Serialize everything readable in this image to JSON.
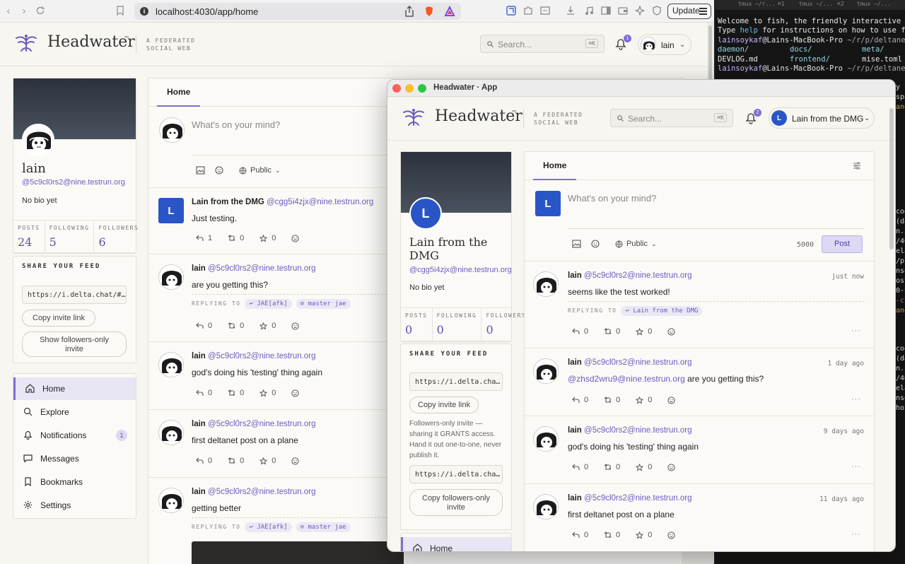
{
  "browser": {
    "url": "localhost:4030/app/home",
    "update_label": "Update"
  },
  "brand": {
    "name": "Headwater",
    "tm": "™",
    "tagline1": "A FEDERATED",
    "tagline2": "SOCIAL WEB"
  },
  "header": {
    "search_placeholder": "Search...",
    "search_kbd": "⌘K"
  },
  "main": {
    "user_name": "lain",
    "notif_count": "1",
    "profile": {
      "name": "lain",
      "handle": "@5c9cl0rs2@nine.testrun.org",
      "bio": "No bio yet",
      "stats": [
        {
          "label": "POSTS",
          "value": "24"
        },
        {
          "label": "FOLLOWING",
          "value": "5"
        },
        {
          "label": "FOLLOWERS",
          "value": "6"
        }
      ],
      "share_title": "SHARE YOUR FEED",
      "feed_link": "https://i.delta.chat/#…",
      "copy_invite": "Copy invite link",
      "followers_invite": "Show followers-only invite"
    },
    "nav": [
      {
        "label": "Home",
        "icon": "home-icon",
        "active": true
      },
      {
        "label": "Explore",
        "icon": "search-icon"
      },
      {
        "label": "Notifications",
        "icon": "bell-icon",
        "count": "1"
      },
      {
        "label": "Messages",
        "icon": "message-icon"
      },
      {
        "label": "Bookmarks",
        "icon": "bookmark-icon"
      },
      {
        "label": "Settings",
        "icon": "gear-icon"
      }
    ],
    "tab": "Home",
    "compose_placeholder": "What's on your mind?",
    "visibility": "Public",
    "posts": [
      {
        "author": "Lain from the DMG",
        "handle": "@cgg5i4zjx@nine.testrun.org",
        "text": "Just testing.",
        "replies": "1",
        "boosts": "0",
        "stars": "0"
      },
      {
        "author": "lain",
        "handle": "@5c9cl0rs2@nine.testrun.org",
        "text": "are you getting this?",
        "reply_label": "REPLYING TO",
        "reply_tag1": "↩ JAE[afk]",
        "reply_tag2": "⊘ master jae",
        "replies": "0",
        "boosts": "0",
        "stars": "0"
      },
      {
        "author": "lain",
        "handle": "@5c9cl0rs2@nine.testrun.org",
        "text": "god's doing his 'testing' thing again",
        "replies": "0",
        "boosts": "0",
        "stars": "0"
      },
      {
        "author": "lain",
        "handle": "@5c9cl0rs2@nine.testrun.org",
        "text": "first deltanet post on a plane",
        "replies": "0",
        "boosts": "0",
        "stars": "0"
      },
      {
        "author": "lain",
        "handle": "@5c9cl0rs2@nine.testrun.org",
        "text": "getting better",
        "reply_label": "REPLYING TO",
        "reply_tag1": "↩ JAE[afk]",
        "reply_tag2": "⊘ master jae"
      }
    ]
  },
  "app": {
    "window_title": "Headwater · App",
    "user_name": "Lain from the DMG",
    "user_initial": "L",
    "notif_count": "2",
    "profile": {
      "name_line1": "Lain from the",
      "name_line2": "DMG",
      "handle": "@cgg5i4zjx@nine.testrun.org",
      "bio": "No bio yet",
      "stats": [
        {
          "label": "POSTS",
          "value": "0"
        },
        {
          "label": "FOLLOWING",
          "value": "0"
        },
        {
          "label": "FOLLOWERS",
          "value": "0"
        }
      ],
      "share_title": "SHARE YOUR FEED",
      "feed_link": "https://i.delta.cha…",
      "copy_invite": "Copy invite link",
      "followers_note": "Followers-only invite — sharing it GRANTS access. Hand it out one-to-one, never publish it.",
      "followers_link": "https://i.delta.cha…",
      "copy_followers": "Copy followers-only invite",
      "nav_home": "Home"
    },
    "tab": "Home",
    "compose_placeholder": "What's on your mind?",
    "visibility": "Public",
    "char_limit": "5000",
    "post_button": "Post",
    "posts": [
      {
        "author": "lain",
        "handle": "@5c9cl0rs2@nine.testrun.org",
        "time": "just now",
        "text": "seems like the test worked!",
        "reply_label": "REPLYING TO",
        "reply_tag": "↩ Lain from the DMG",
        "replies": "0",
        "boosts": "0",
        "stars": "0"
      },
      {
        "author": "lain",
        "handle": "@5c9cl0rs2@nine.testrun.org",
        "time": "1 day ago",
        "mention": "@zhsd2wru9@nine.testrun.org",
        "text": "are you getting this?",
        "replies": "0",
        "boosts": "0",
        "stars": "0"
      },
      {
        "author": "lain",
        "handle": "@5c9cl0rs2@nine.testrun.org",
        "time": "9 days ago",
        "text": "god's doing his 'testing' thing again",
        "replies": "0",
        "boosts": "0",
        "stars": "0"
      },
      {
        "author": "lain",
        "handle": "@5c9cl0rs2@nine.testrun.org",
        "time": "11 days ago",
        "text": "first deltanet post on a plane",
        "replies": "0",
        "boosts": "0",
        "stars": "0"
      }
    ]
  },
  "terminal": {
    "tabs": [
      "tmux ~/r...",
      "⌘1",
      "tmux ~/...",
      "⌘2",
      "tmux ~/..."
    ],
    "line1": "Welcome to fish, the friendly interactive",
    "line2a": "Type ",
    "line2b": "help",
    "line2c": " for instructions on how to use f",
    "prompt_user": "lainsoykaf",
    "prompt_host": "@Lains-MacBook-Pro",
    "prompt_path": " ~/r/p/deltane",
    "ls1": [
      "daemon/",
      "docs/",
      "meta/"
    ],
    "ls2": [
      "DEVLOG.md",
      "frontend/",
      "mise.toml"
    ],
    "right_frags": [
      "y",
      "spa",
      "ane",
      "coo",
      "(da",
      "n.i",
      "/40",
      "ela",
      "/pl",
      "nso",
      "ost",
      "0-u",
      "-cl",
      "ane",
      "coo",
      "(da",
      "n.i",
      "/40",
      "ela",
      "nso",
      "hos"
    ]
  },
  "colors": {
    "accent": "#7d6fd6",
    "handle": "#6c5cc0",
    "avatar_blue": "#2a55c6"
  }
}
